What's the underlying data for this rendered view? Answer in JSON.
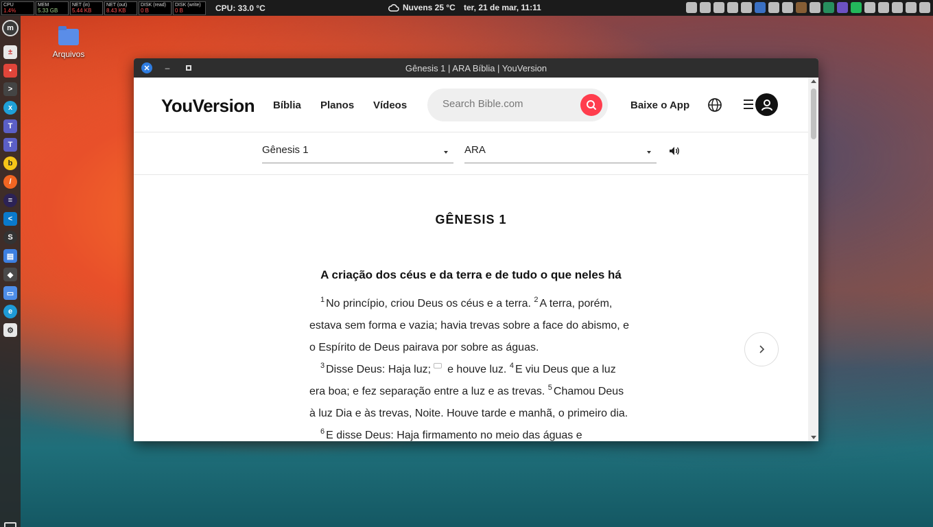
{
  "top_panel": {
    "monitors": [
      {
        "label": "CPU",
        "value": "1.4%"
      },
      {
        "label": "MEM",
        "value": "5.33 GB"
      },
      {
        "label": "NET (in)",
        "value": "5.44 KB"
      },
      {
        "label": "NET (out)",
        "value": "8.43 KB"
      },
      {
        "label": "DISK (read)",
        "value": "0 B"
      },
      {
        "label": "DISK (write)",
        "value": "0 B"
      }
    ],
    "cpu_temp": "CPU: 33.0 °C",
    "weather": "Nuvens 25 °C",
    "clock": "ter, 21 de mar, 11:11"
  },
  "desktop": {
    "folder_label": "Arquivos"
  },
  "window": {
    "title": "Gênesis 1 | ARA Bíblia | YouVersion"
  },
  "site": {
    "logo": "YouVersion",
    "nav": [
      "Bíblia",
      "Planos",
      "Vídeos"
    ],
    "search_placeholder": "Search Bible.com",
    "download_label": "Baixe o App",
    "book_select": "Gênesis 1",
    "version_select": "ARA",
    "chapter_title": "GÊNESIS 1",
    "section_heading": "A criação dos céus e da terra e de tudo o que neles há",
    "verses": {
      "v1_num": "1",
      "v1": "No princípio, criou Deus os céus e a terra.",
      "v2_num": "2",
      "v2": "A terra, porém, estava sem forma e vazia; havia trevas sobre a face do abismo, e o Espírito de Deus pairava por sobre as águas.",
      "v3_num": "3",
      "v3a": "Disse Deus: Haja luz;",
      "v3b": "e houve luz.",
      "v4_num": "4",
      "v4": "E viu Deus que a luz era boa; e fez separação entre a luz e as trevas.",
      "v5_num": "5",
      "v5": "Chamou Deus à luz Dia e às trevas, Noite. Houve tarde e manhã, o primeiro dia.",
      "v6_num": "6",
      "v6": "E disse Deus: Haja firmamento no meio das águas e"
    }
  },
  "colors": {
    "search_button": "#ff3d4d",
    "close_button": "#2f7de1"
  }
}
